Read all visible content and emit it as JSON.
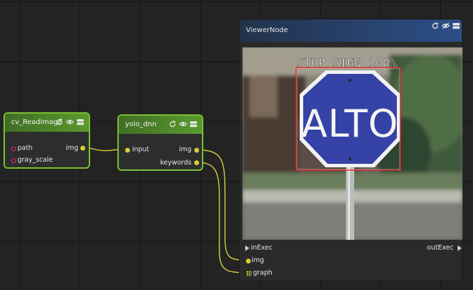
{
  "nodes": {
    "read_image": {
      "title": "cv_ReadImage",
      "inputs": [
        {
          "label": "path"
        },
        {
          "label": "gray_scale"
        }
      ],
      "outputs": [
        {
          "label": "img"
        }
      ]
    },
    "yolo": {
      "title": "yolo_dnn",
      "inputs": [
        {
          "label": "input"
        }
      ],
      "outputs": [
        {
          "label": "img"
        },
        {
          "label": "keywords"
        }
      ]
    },
    "viewer": {
      "title": "ViewerNode",
      "detection_label": "STOP SIGN 100%",
      "sign_text": "ALTO",
      "ports": {
        "in_exec": "inExec",
        "out_exec": "outExec",
        "img": "img",
        "graph": "graph"
      }
    }
  },
  "icons": [
    "refresh-icon",
    "eye-icon",
    "stack-icon"
  ],
  "colors": {
    "node_border_green": "#7ac231",
    "port_yellow": "#d8cf36",
    "port_pink": "#e0306a",
    "viewer_header": "#2c4f88",
    "detection_box": "#e02020"
  }
}
